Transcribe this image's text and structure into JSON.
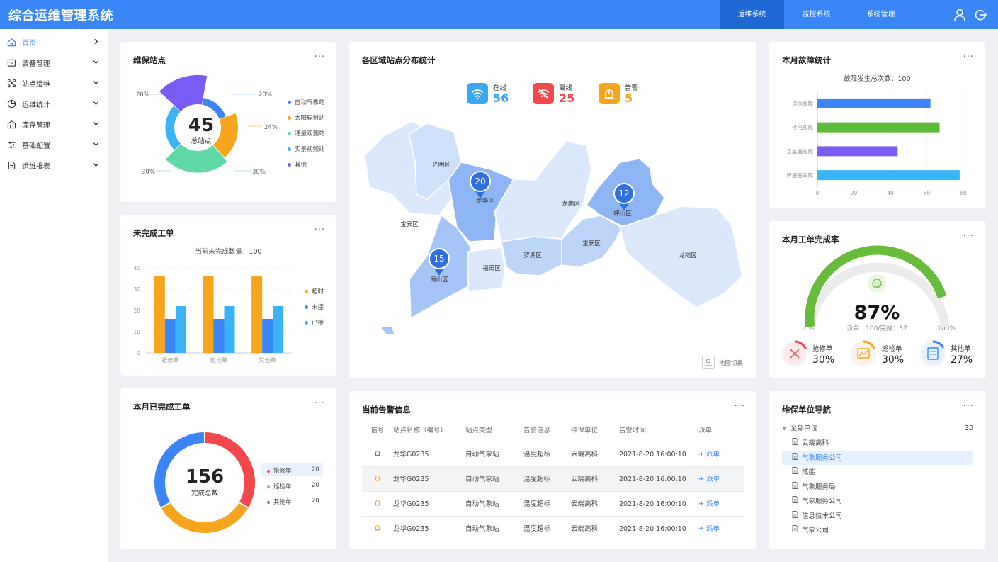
{
  "app": {
    "title": "综合运维管理系统"
  },
  "topnav": [
    {
      "label": "运维系统",
      "active": true
    },
    {
      "label": "监控系统",
      "active": false
    },
    {
      "label": "系统管理",
      "active": false
    }
  ],
  "topicons": [
    "user-icon",
    "logout-icon"
  ],
  "sidebar": {
    "items": [
      {
        "label": "首页",
        "icon": "home-icon",
        "chevron": "right",
        "active": true
      },
      {
        "label": "装备管理",
        "icon": "equipment-icon",
        "chevron": "down"
      },
      {
        "label": "站点运维",
        "icon": "station-icon",
        "chevron": "down"
      },
      {
        "label": "运维统计",
        "icon": "stats-icon",
        "chevron": "down"
      },
      {
        "label": "库存管理",
        "icon": "warehouse-icon",
        "chevron": "down"
      },
      {
        "label": "基础配置",
        "icon": "config-icon",
        "chevron": "down"
      },
      {
        "label": "运维报表",
        "icon": "report-icon",
        "chevron": "down"
      }
    ]
  },
  "more": "···",
  "stations": {
    "title": "维保站点",
    "total": "45",
    "total_label": "总站点",
    "legend": [
      "自动气象站",
      "太阳辐射站",
      "通量观测站",
      "实景视频站",
      "其他"
    ],
    "pct_labels": [
      "20%",
      "24%",
      "30%",
      "30%",
      "20%"
    ]
  },
  "unfinished": {
    "title": "未完成工单",
    "subtitle": "当前未完成数量：100",
    "legend": [
      "超时",
      "未接",
      "已接"
    ]
  },
  "completed": {
    "title": "本月已完成工单",
    "total": "156",
    "total_label": "完成总数",
    "legend": [
      {
        "label": "抢修单",
        "value": "20"
      },
      {
        "label": "巡检单",
        "value": "20"
      },
      {
        "label": "其他单",
        "value": "20"
      }
    ]
  },
  "map": {
    "title": "各区域站点分布统计",
    "status": [
      {
        "label": "在线",
        "value": "56",
        "color": "#3aa8f0"
      },
      {
        "label": "离线",
        "value": "25",
        "color": "#f2484b"
      },
      {
        "label": "告警",
        "value": "5",
        "color": "#f7a51c"
      }
    ],
    "districts": [
      "光明区",
      "龙华区",
      "龙岗区",
      "坪山区",
      "宝安区",
      "宝安区",
      "罗湖区",
      "福田区",
      "南山区",
      "龙岗区"
    ],
    "pins": [
      "20",
      "12",
      "15"
    ],
    "switch_label": "地图切换"
  },
  "alarms": {
    "title": "当前告警信息",
    "headers": [
      "信号",
      "站点名称（编号）",
      "站点类型",
      "告警信息",
      "维保单位",
      "告警时间",
      "派单"
    ],
    "rows": [
      {
        "name": "龙华G0235",
        "type": "自动气象站",
        "info": "温度超标",
        "unit": "云端高科",
        "time": "2021-8-20 16:00:10",
        "action": "派单",
        "signal": "red"
      },
      {
        "name": "龙华G0235",
        "type": "自动气象站",
        "info": "温度超标",
        "unit": "云端高科",
        "time": "2021-8-20 16:00:10",
        "action": "派单",
        "signal": "orange"
      },
      {
        "name": "龙华G0235",
        "type": "自动气象站",
        "info": "温度超标",
        "unit": "云端高科",
        "time": "2021-8-20 16:00:10",
        "action": "派单",
        "signal": "orange"
      },
      {
        "name": "龙华G0235",
        "type": "自动气象站",
        "info": "温度超标",
        "unit": "云端高科",
        "time": "2021-8-20 16:00:10",
        "action": "派单",
        "signal": "orange"
      }
    ]
  },
  "faults": {
    "title": "本月故障统计",
    "subtitle": "故障发生总次数：100"
  },
  "completion": {
    "title": "本月工单完成率",
    "value": "87%",
    "min": "0%",
    "max": "100%",
    "detail": "派单：100/完成：87",
    "items": [
      {
        "label": "抢修单",
        "value": "30%",
        "color": "#f2484b"
      },
      {
        "label": "巡检单",
        "value": "30%",
        "color": "#f7a51c"
      },
      {
        "label": "其他单",
        "value": "27%",
        "color": "#3a86f6"
      }
    ]
  },
  "units": {
    "title": "维保单位导航",
    "root": "全部单位",
    "count": "30",
    "items": [
      "云端高科",
      "气象服务公司",
      "炫能",
      "气象服务局",
      "气象服务公司",
      "信息技术公司",
      "气象公司"
    ],
    "selected": 1
  },
  "chart_data": [
    {
      "type": "pie",
      "title": "维保站点",
      "categories": [
        "自动气象站",
        "太阳辐射站",
        "通量观测站",
        "实景视频站",
        "其他"
      ],
      "values": [
        20,
        24,
        30,
        30,
        20
      ],
      "colors": [
        "#3a86f6",
        "#f7a51c",
        "#5fd9a5",
        "#3ab4f7",
        "#7a5cf4"
      ]
    },
    {
      "type": "bar",
      "title": "未完成工单",
      "categories": [
        "抢修单",
        "巡检单",
        "其他单"
      ],
      "ylim": [
        0,
        40
      ],
      "yticks": [
        0,
        10,
        20,
        30,
        40
      ],
      "series": [
        {
          "name": "超时",
          "values": [
            36,
            36,
            36
          ],
          "color": "#f7a51c"
        },
        {
          "name": "未接",
          "values": [
            16,
            16,
            16
          ],
          "color": "#3a86f6"
        },
        {
          "name": "已接",
          "values": [
            22,
            22,
            22
          ],
          "color": "#3ab4f7"
        }
      ]
    },
    {
      "type": "pie",
      "title": "本月已完成工单",
      "categories": [
        "抢修单",
        "巡检单",
        "其他单"
      ],
      "values": [
        20,
        20,
        20
      ],
      "colors": [
        "#f2484b",
        "#f7a51c",
        "#3a86f6"
      ]
    },
    {
      "type": "bar",
      "orientation": "horizontal",
      "title": "本月故障统计",
      "categories": [
        "通信故障",
        "供电故障",
        "采集器故障",
        "传感器故障"
      ],
      "values": [
        62,
        67,
        44,
        78
      ],
      "colors": [
        "#3a86f6",
        "#5bbd3a",
        "#7a5cf4",
        "#3ab4f7"
      ],
      "xlim": [
        0,
        80
      ],
      "xticks": [
        0,
        20,
        40,
        60,
        80
      ]
    },
    {
      "type": "gauge",
      "title": "本月工单完成率",
      "value": 87,
      "min": 0,
      "max": 100,
      "color": "#67bd3b"
    }
  ]
}
